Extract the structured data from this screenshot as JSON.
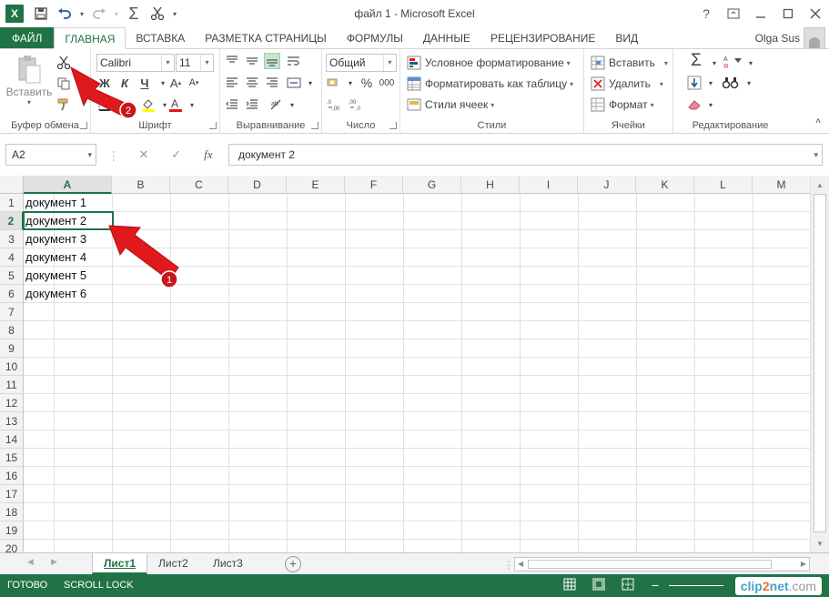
{
  "window": {
    "title": "файл 1 - Microsoft Excel",
    "help": "?"
  },
  "tabs": {
    "file": "ФАЙЛ",
    "items": [
      "ГЛАВНАЯ",
      "ВСТАВКА",
      "РАЗМЕТКА СТРАНИЦЫ",
      "ФОРМУЛЫ",
      "ДАННЫЕ",
      "РЕЦЕНЗИРОВАНИЕ",
      "ВИД"
    ],
    "user": "Olga Sus"
  },
  "ribbon": {
    "clipboard": {
      "label": "Буфер обмена",
      "paste": "Вставить"
    },
    "font": {
      "label": "Шрифт",
      "name": "Calibri",
      "size": "11",
      "bold": "Ж",
      "italic": "К",
      "underline": "Ч"
    },
    "alignment": {
      "label": "Выравнивание"
    },
    "number": {
      "label": "Число",
      "format": "Общий",
      "percent": "%",
      "thousands": "000"
    },
    "styles": {
      "label": "Стили",
      "conditional": "Условное форматирование",
      "table": "Форматировать как таблицу",
      "cell_styles": "Стили ячеек"
    },
    "cells": {
      "label": "Ячейки",
      "insert": "Вставить",
      "delete": "Удалить",
      "format": "Формат"
    },
    "editing": {
      "label": "Редактирование"
    }
  },
  "formula_bar": {
    "name_box": "A2",
    "fx": "fx",
    "value": "документ 2"
  },
  "columns": [
    "A",
    "B",
    "C",
    "D",
    "E",
    "F",
    "G",
    "H",
    "I",
    "J",
    "K",
    "L",
    "M"
  ],
  "rows": [
    "1",
    "2",
    "3",
    "4",
    "5",
    "6",
    "7",
    "8",
    "9",
    "10",
    "11",
    "12",
    "13",
    "14",
    "15",
    "16",
    "17",
    "18",
    "19",
    "20"
  ],
  "cells": [
    "документ 1",
    "документ 2",
    "документ 3",
    "документ 4",
    "документ 5",
    "документ 6"
  ],
  "sheets": [
    "Лист1",
    "Лист2",
    "Лист3"
  ],
  "status": {
    "ready": "ГОТОВО",
    "scroll_lock": "SCROLL LOCK"
  },
  "annotations": {
    "arrow1": "1",
    "arrow2": "2"
  },
  "watermark": {
    "a": "clip",
    "b": "2",
    "c": "net",
    "d": ".com"
  },
  "colors": {
    "accent": "#217346",
    "arrow": "#e0191c"
  }
}
